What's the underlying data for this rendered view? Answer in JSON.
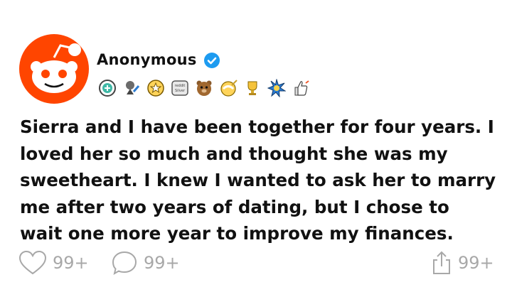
{
  "post": {
    "author": "Anonymous",
    "verified": true,
    "awards": [
      "wholesome-award-icon",
      "medal-award-icon",
      "star-award-icon",
      "silver-award-icon",
      "bear-award-icon",
      "narwhal-award-icon",
      "trophy-award-icon",
      "burst-award-icon",
      "thumbs-up-rocket-award-icon"
    ],
    "award_text": {
      "silver": "reddit Silver"
    },
    "body": "Sierra and I have been together for four years. I loved her so much and thought she was my sweetheart. I knew I wanted to ask her to marry me after two years of dating, but I chose to wait one more year to improve my finances."
  },
  "actions": {
    "likes": "99+",
    "comments": "99+",
    "shares": "99+"
  },
  "colors": {
    "brand_red": "#ff4500",
    "verified_blue": "#1d9bf0",
    "muted_gray": "#a8a8a8",
    "text": "#111111"
  }
}
